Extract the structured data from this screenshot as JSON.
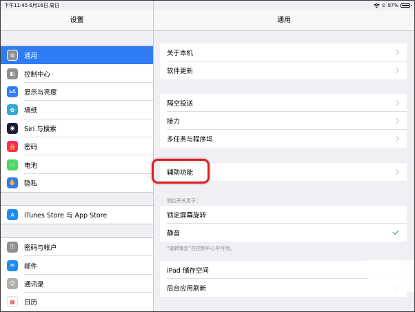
{
  "status_bar": {
    "time_date": "下午11:45  6月16日 周日",
    "battery_percent": "97%",
    "battery_level": 0.97
  },
  "left": {
    "title": "设置",
    "groups": [
      [
        {
          "label": "通用",
          "icon": "gear-icon",
          "color": "#8e8e93",
          "selected": true
        },
        {
          "label": "控制中心",
          "icon": "switches-icon",
          "color": "#8e8e93"
        },
        {
          "label": "显示与亮度",
          "icon": "text-size-icon",
          "color": "#2f7cf6"
        },
        {
          "label": "墙纸",
          "icon": "flower-icon",
          "color": "#34aadc"
        },
        {
          "label": "Siri 与搜索",
          "icon": "siri-icon",
          "color": "#1c1c3a"
        },
        {
          "label": "密码",
          "icon": "lock-icon",
          "color": "#ff2d55"
        },
        {
          "label": "电池",
          "icon": "battery-icon",
          "color": "#4cd964"
        },
        {
          "label": "隐私",
          "icon": "hand-icon",
          "color": "#2f7cf6"
        }
      ],
      [
        {
          "label": "iTunes Store 与 App Store",
          "icon": "app-store-icon",
          "color": "#1b8cf5"
        }
      ],
      [
        {
          "label": "密码与帐户",
          "icon": "key-icon",
          "color": "#8e8e93"
        },
        {
          "label": "邮件",
          "icon": "mail-icon",
          "color": "#1b8cf5"
        },
        {
          "label": "通讯录",
          "icon": "contacts-icon",
          "color": "#b0aea9"
        },
        {
          "label": "日历",
          "icon": "calendar-icon",
          "color": "#ffffff"
        }
      ]
    ]
  },
  "right": {
    "title": "通用",
    "group1": [
      "关于本机",
      "软件更新"
    ],
    "group2": [
      "隔空投送",
      "接力",
      "多任务与程序坞"
    ],
    "group3": [
      "辅助功能"
    ],
    "side_switch_header": "侧边开关用于：",
    "group4": [
      "锁定屏幕旋转",
      "静音"
    ],
    "side_switch_footer": "“旋转锁定”在控制中心中可用。",
    "group5": [
      "iPad 储存空间",
      "后台应用刷新"
    ]
  }
}
